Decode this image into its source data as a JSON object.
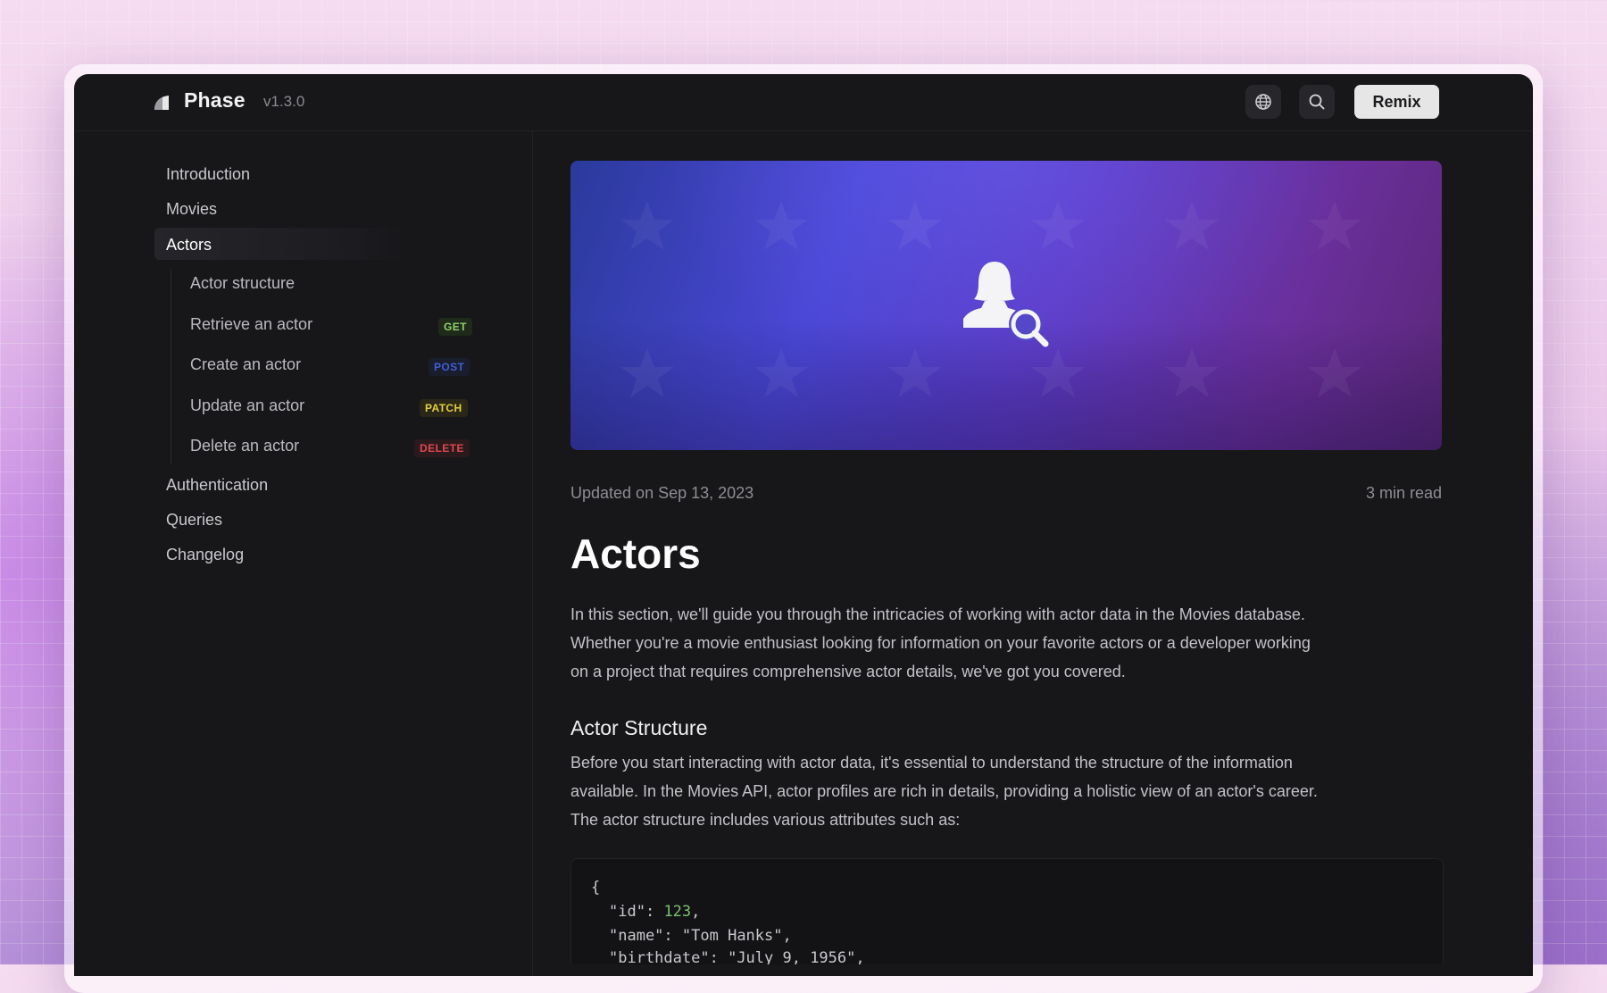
{
  "app": {
    "brand": "Phase",
    "version": "v1.3.0",
    "remix_label": "Remix"
  },
  "icons": {
    "logo": "phase-logo-icon",
    "language": "globe-icon",
    "search": "search-icon",
    "hero": "actor-search-icon"
  },
  "sidebar": {
    "top_items": [
      {
        "label": "Introduction"
      },
      {
        "label": "Movies"
      }
    ],
    "active_item": {
      "label": "Actors"
    },
    "sub_items": [
      {
        "label": "Actor structure",
        "badge": ""
      },
      {
        "label": "Retrieve an actor",
        "badge": "GET",
        "badge_color": "#8fd16a"
      },
      {
        "label": "Create an actor",
        "badge": "POST",
        "badge_color": "#3f5fd8"
      },
      {
        "label": "Update an actor",
        "badge": "PATCH",
        "badge_color": "#e5cf3a"
      },
      {
        "label": "Delete an actor",
        "badge": "DELETE",
        "badge_color": "#e0484f"
      }
    ],
    "bottom_items": [
      {
        "label": "Authentication"
      },
      {
        "label": "Queries"
      },
      {
        "label": "Changelog"
      }
    ]
  },
  "article": {
    "updated": "Updated on Sep 13, 2023",
    "read_time": "3 min read",
    "title": "Actors",
    "intro_lines": [
      "In this section, we'll guide you through the intricacies of working with actor data in the Movies database.",
      "Whether you're a movie enthusiast looking for information on your favorite actors or a developer working",
      "on a project that requires comprehensive actor details, we've got you covered."
    ],
    "section_title": "Actor Structure",
    "section_lines": [
      "Before you start interacting with actor data, it's essential to understand the structure of the information",
      "available. In the Movies API, actor profiles are rich in details, providing a holistic view of an actor's career.",
      "The actor structure includes various attributes such as:"
    ],
    "code": {
      "open_brace": "{",
      "lines": [
        {
          "key": "\"id\"",
          "sep": ": ",
          "value": "123",
          "kind": "num",
          "tail": ","
        },
        {
          "key": "\"name\"",
          "sep": ": ",
          "value": "\"Tom Hanks\"",
          "kind": "str",
          "tail": ","
        },
        {
          "key": "\"birthdate\"",
          "sep": ": ",
          "value": "\"July 9, 1956\"",
          "kind": "str",
          "tail": ","
        }
      ]
    }
  }
}
